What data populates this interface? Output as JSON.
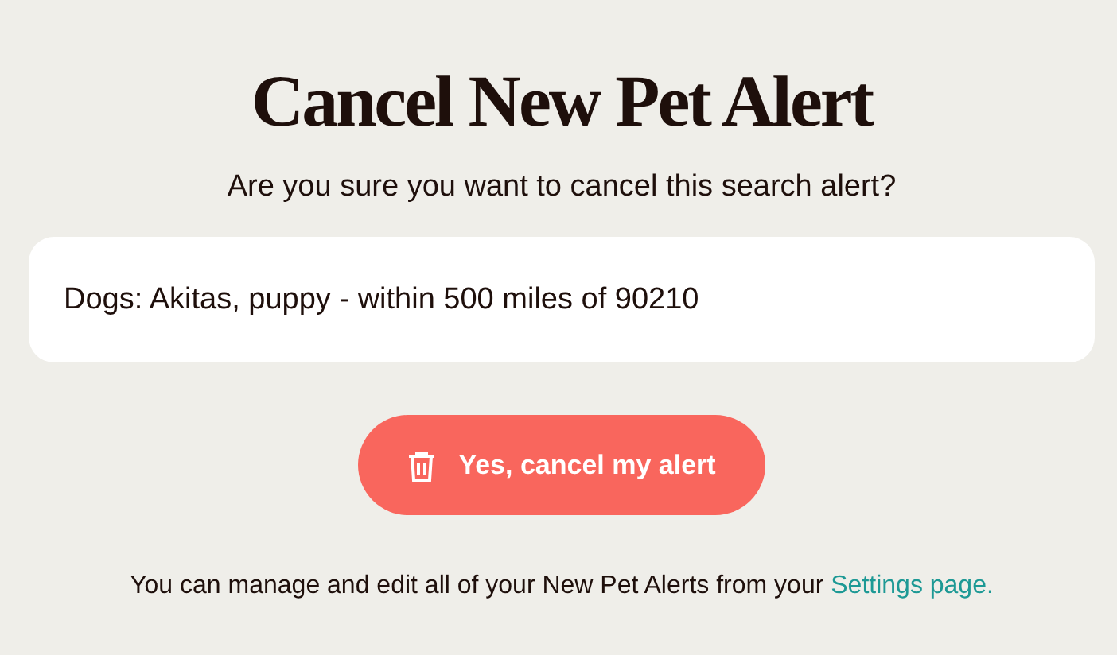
{
  "title": "Cancel New Pet Alert",
  "subtitle": "Are you sure you want to cancel this search alert?",
  "alert": {
    "description": "Dogs: Akitas, puppy - within 500 miles of 90210"
  },
  "confirm_button": {
    "label": "Yes, cancel my alert"
  },
  "footer": {
    "text": "You can manage and edit all of your New Pet Alerts from your",
    "link": "Settings page."
  }
}
